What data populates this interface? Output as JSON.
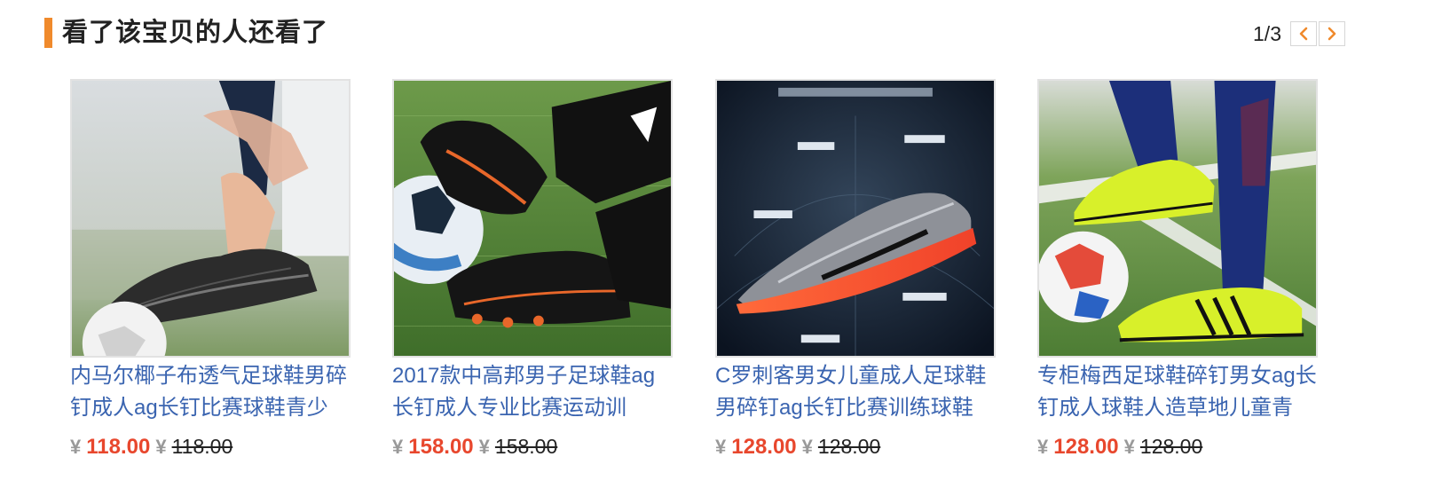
{
  "header": {
    "title": "看了该宝贝的人还看了",
    "page_indicator": "1/3",
    "accent_color": "#f08a2c",
    "prev_icon": "chevron-left-icon",
    "next_icon": "chevron-right-icon"
  },
  "products": [
    {
      "title": "内马尔椰子布透气足球鞋男碎钉成人ag长钉比赛球鞋青少",
      "currency": "¥",
      "price": "118.00",
      "original_currency": "¥",
      "original_price": "118.00"
    },
    {
      "title": "2017款中高邦男子足球鞋ag长钉成人专业比赛运动训",
      "currency": "¥",
      "price": "158.00",
      "original_currency": "¥",
      "original_price": "158.00"
    },
    {
      "title": "C罗刺客男女儿童成人足球鞋男碎钉ag长钉比赛训练球鞋",
      "currency": "¥",
      "price": "128.00",
      "original_currency": "¥",
      "original_price": "128.00"
    },
    {
      "title": "专柜梅西足球鞋碎钉男女ag长钉成人球鞋人造草地儿童青",
      "currency": "¥",
      "price": "128.00",
      "original_currency": "¥",
      "original_price": "128.00"
    }
  ],
  "colors": {
    "link": "#3a64b0",
    "price": "#e8472d",
    "muted": "#999999"
  }
}
